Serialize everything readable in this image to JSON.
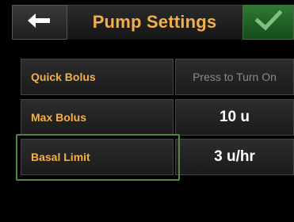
{
  "header": {
    "title": "Pump Settings",
    "back_icon": "left-arrow-icon",
    "confirm_icon": "checkmark-icon"
  },
  "settings": [
    {
      "label": "Quick Bolus",
      "value": "Press to Turn On"
    },
    {
      "label": "Max Bolus",
      "value": "10 u"
    },
    {
      "label": "Basal Limit",
      "value": "3 u/hr"
    }
  ],
  "colors": {
    "accent_label": "#f2b04a",
    "confirm_green": "#2e7a33",
    "highlight_border": "#4d8a3e"
  }
}
